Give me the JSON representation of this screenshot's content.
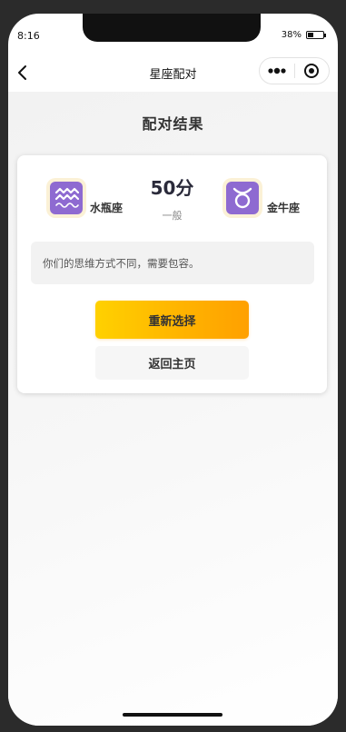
{
  "status": {
    "time": "8:16",
    "battery": "38%"
  },
  "navbar": {
    "title": "星座配对",
    "back_icon": "chevron-left-icon",
    "more_icon": "more-dots-icon",
    "close_icon": "target-circle-icon"
  },
  "page": {
    "title": "配对结果"
  },
  "result": {
    "left_sign": {
      "name": "水瓶座",
      "icon": "aquarius-icon"
    },
    "right_sign": {
      "name": "金牛座",
      "icon": "taurus-icon"
    },
    "score": "50分",
    "level": "一般",
    "message": "你们的思维方式不同，需要包容。"
  },
  "buttons": {
    "reselect": "重新选择",
    "home": "返回主页"
  },
  "colors": {
    "sign_icon_bg": "#8e6ad1",
    "button_gradient_start": "#ffd100",
    "button_gradient_end": "#ffa000"
  }
}
